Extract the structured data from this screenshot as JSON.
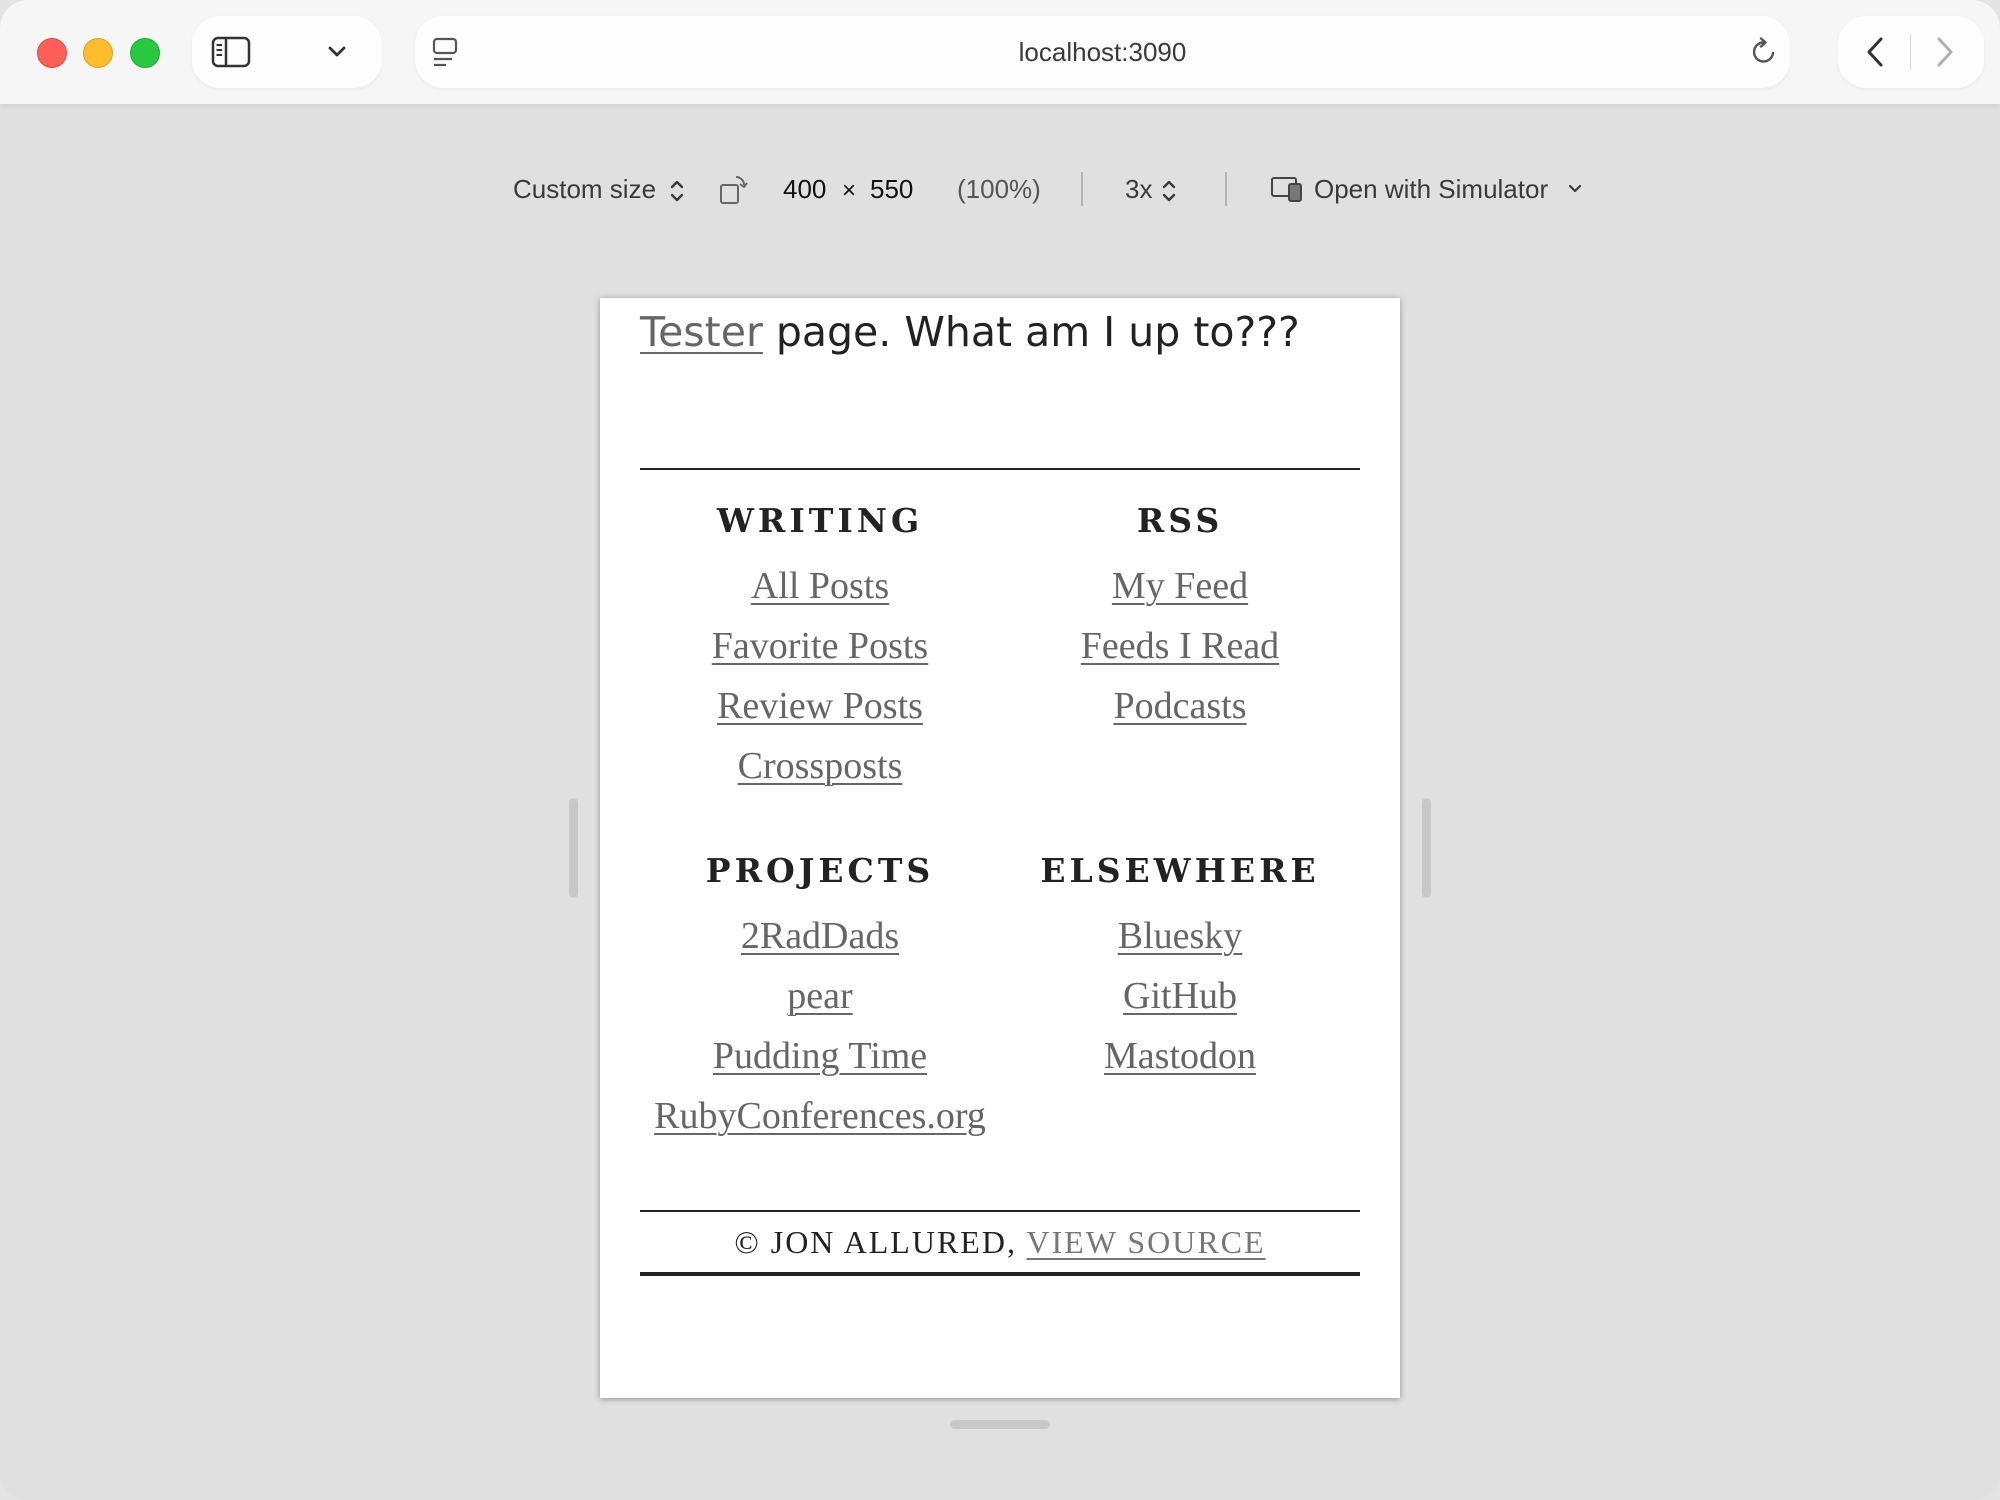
{
  "browser": {
    "url": "localhost:3090",
    "colors": {
      "close": "#fe5f57",
      "minimize": "#febc2e",
      "maximize": "#28c840"
    }
  },
  "responsive_bar": {
    "size_preset": "Custom size",
    "width": "400",
    "times": "×",
    "height": "550",
    "zoom": "(100%)",
    "scale": "3x",
    "open_with": "Open with Simulator"
  },
  "page": {
    "intro_link": "Tester",
    "intro_text": " page. What am I up to???",
    "sections": {
      "writing": {
        "heading": "WRITING",
        "links": [
          "All Posts",
          "Favorite Posts",
          "Review Posts",
          "Crossposts"
        ]
      },
      "rss": {
        "heading": "RSS",
        "links": [
          "My Feed",
          "Feeds I Read",
          "Podcasts"
        ]
      },
      "projects": {
        "heading": "PROJECTS",
        "links": [
          "2RadDads",
          "pear",
          "Pudding Time",
          "RubyConferences.org"
        ]
      },
      "elsewhere": {
        "heading": "ELSEWHERE",
        "links": [
          "Bluesky",
          "GitHub",
          "Mastodon"
        ]
      }
    },
    "footer": {
      "copyright": "© JON ALLURED, ",
      "source_link": "VIEW SOURCE"
    }
  }
}
